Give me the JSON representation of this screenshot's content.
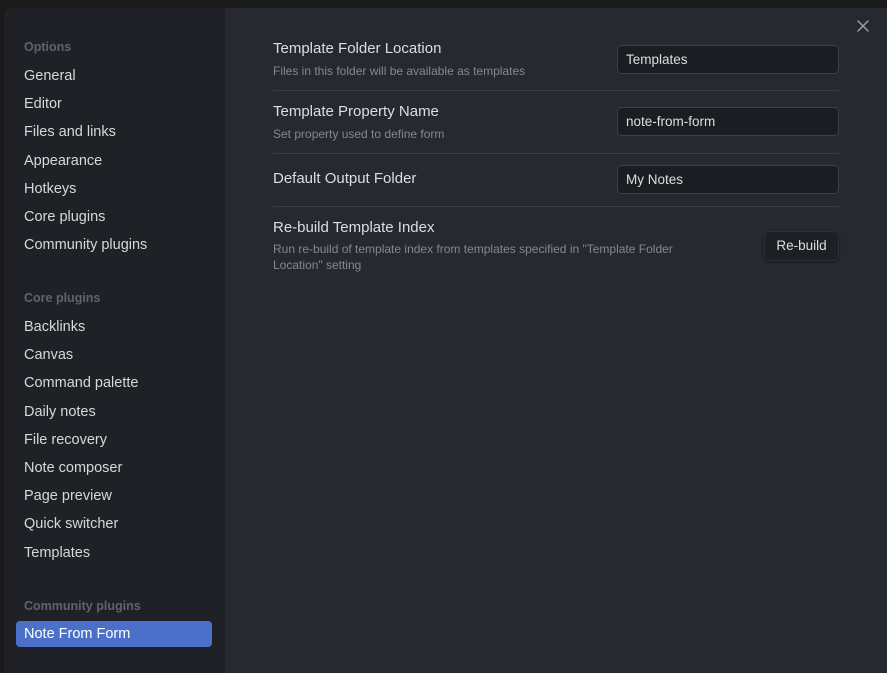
{
  "sidebar": {
    "sections": [
      {
        "title": "Options",
        "items": [
          "General",
          "Editor",
          "Files and links",
          "Appearance",
          "Hotkeys",
          "Core plugins",
          "Community plugins"
        ]
      },
      {
        "title": "Core plugins",
        "items": [
          "Backlinks",
          "Canvas",
          "Command palette",
          "Daily notes",
          "File recovery",
          "Note composer",
          "Page preview",
          "Quick switcher",
          "Templates"
        ]
      },
      {
        "title": "Community plugins",
        "items": [
          "Note From Form"
        ]
      }
    ],
    "active_item": "Note From Form"
  },
  "settings": {
    "template_folder": {
      "name": "Template Folder Location",
      "desc": "Files in this folder will be available as templates",
      "value": "Templates"
    },
    "template_property": {
      "name": "Template Property Name",
      "desc": "Set property used to define form",
      "value": "note-from-form"
    },
    "output_folder": {
      "name": "Default Output Folder",
      "value": "My Notes"
    },
    "rebuild": {
      "name": "Re-build Template Index",
      "desc": "Run re-build of template index from templates specified in \"Template Folder Location\" setting",
      "button_label": "Re-build"
    }
  },
  "icons": {
    "close": "close-icon"
  },
  "colors": {
    "accent": "#4b70c9",
    "sidebar_bg": "#1f2127",
    "content_bg": "#262930"
  }
}
